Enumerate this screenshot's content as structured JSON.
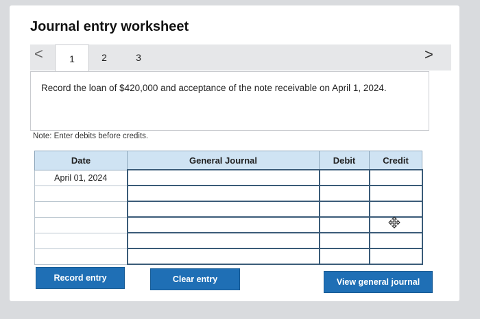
{
  "worksheet": {
    "title": "Journal entry worksheet",
    "nav_prev": "<",
    "nav_next": ">",
    "tabs": [
      "1",
      "2",
      "3"
    ],
    "active_tab": "1"
  },
  "instruction": "Record the loan of $420,000 and acceptance of the note receivable on April 1, 2024.",
  "note": "Note: Enter debits before credits.",
  "table": {
    "headers": [
      "Date",
      "General Journal",
      "Debit",
      "Credit"
    ],
    "rows": [
      {
        "date": "April 01, 2024",
        "account": "",
        "debit": "",
        "credit": ""
      },
      {
        "date": "",
        "account": "",
        "debit": "",
        "credit": ""
      },
      {
        "date": "",
        "account": "",
        "debit": "",
        "credit": ""
      },
      {
        "date": "",
        "account": "",
        "debit": "",
        "credit": ""
      },
      {
        "date": "",
        "account": "",
        "debit": "",
        "credit": ""
      },
      {
        "date": "",
        "account": "",
        "debit": "",
        "credit": ""
      }
    ]
  },
  "buttons": {
    "record": "Record entry",
    "clear": "Clear entry",
    "view": "View general journal"
  },
  "colors": {
    "button": "#1f6fb5",
    "header": "#cfe3f3"
  }
}
